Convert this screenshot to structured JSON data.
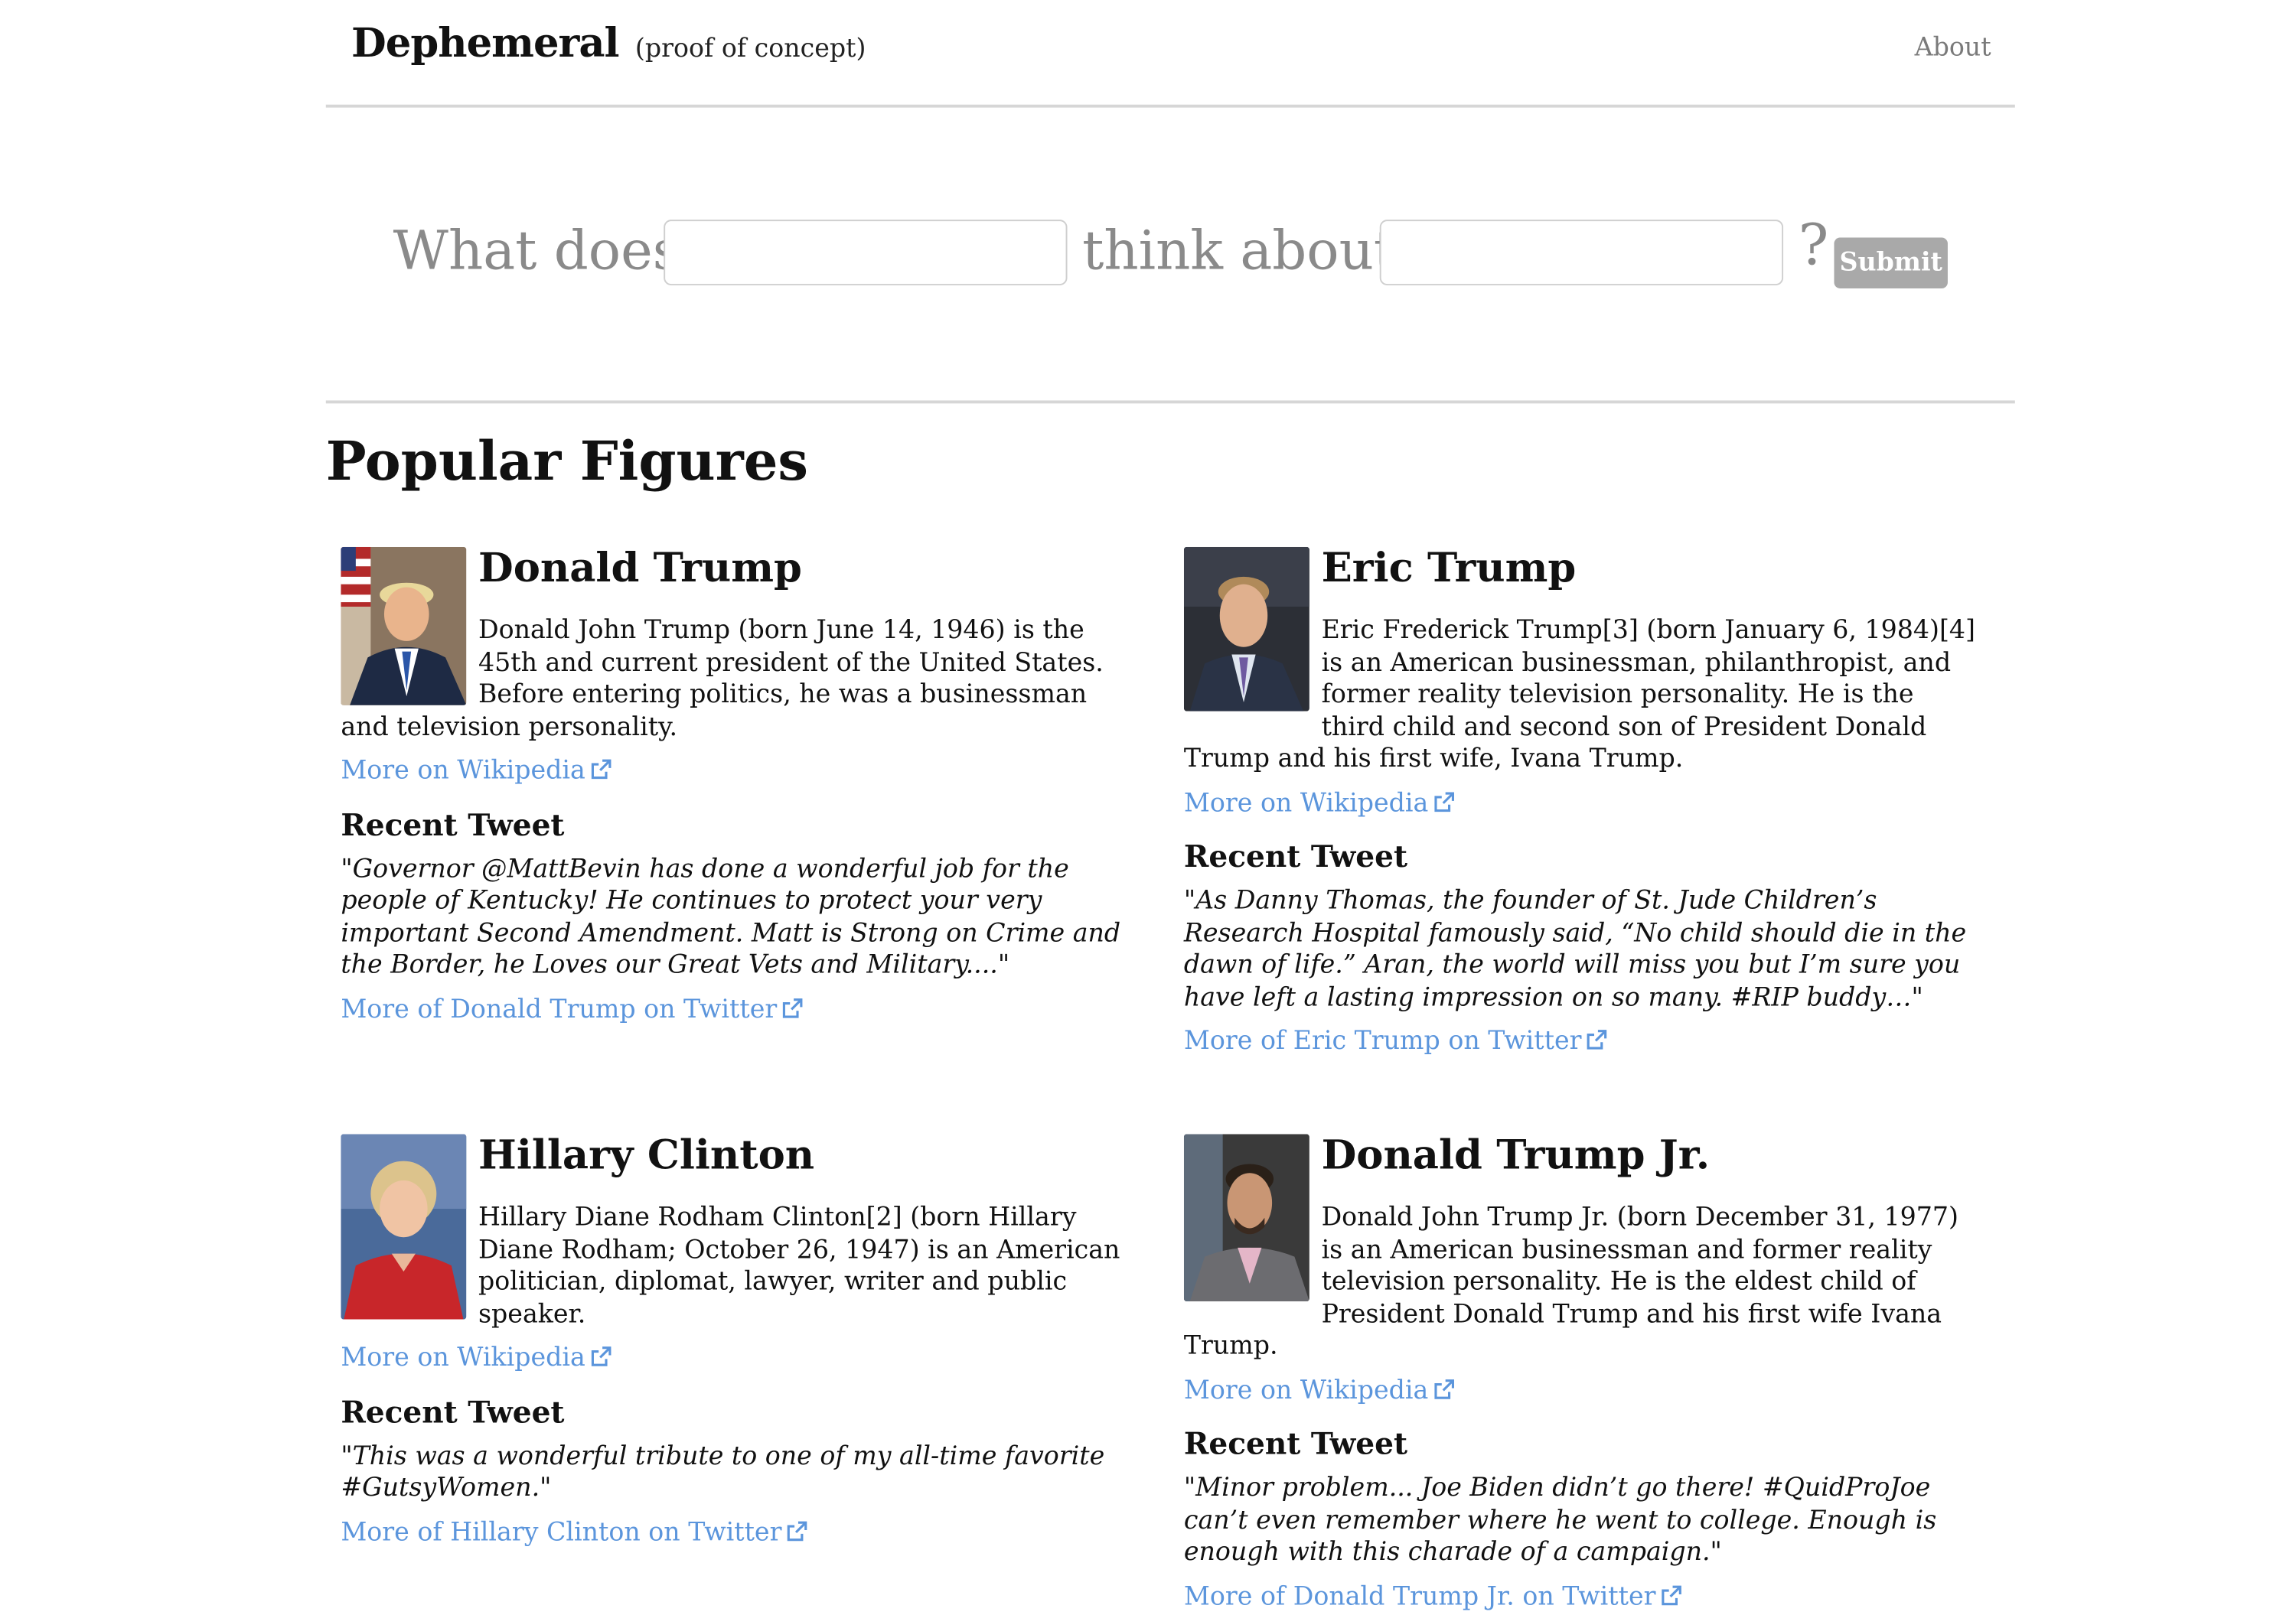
{
  "navbar": {
    "brand": "Dephemeral",
    "brand_sub": "(proof of concept)",
    "about": "About"
  },
  "search": {
    "prefix": "What does",
    "middle": "think about",
    "suffix": "?",
    "person_value": "",
    "topic_value": "",
    "submit": "Submit"
  },
  "popular": {
    "title": "Popular Figures",
    "recent_tweet_label": "Recent Tweet",
    "wiki_label": "More on Wikipedia",
    "figures": [
      {
        "name": "Donald Trump",
        "bio": "Donald John Trump (born June 14, 1946) is the 45th and current president of the United States. Before entering politics, he was a businessman and television personality.",
        "tweet": "\"Governor @MattBevin has done a wonderful job for the people of Kentucky! He continues to protect your very important Second Amendment. Matt is Strong on Crime and the Border, he Loves our Great Vets and Military....\"",
        "twitter_link": "More of Donald Trump on Twitter",
        "avatar_icon": "portrait-donald-trump"
      },
      {
        "name": "Eric Trump",
        "bio": "Eric Frederick Trump[3] (born January 6, 1984)[4] is an American businessman, philanthropist, and former reality television personality. He is the third child and second son of President Donald Trump and his first wife, Ivana Trump.",
        "tweet": "\"As Danny Thomas, the founder of St. Jude Children’s Research Hospital famously said, “No child should die in the dawn of life.” Aran, the world will miss you but I’m sure you have left a lasting impression on so many. #RIP buddy…\"",
        "twitter_link": "More of Eric Trump on Twitter",
        "avatar_icon": "portrait-eric-trump"
      },
      {
        "name": "Hillary Clinton",
        "bio": "Hillary Diane Rodham Clinton[2] (born Hillary Diane Rodham; October 26, 1947) is an American politician, diplomat, lawyer, writer and public speaker.",
        "tweet": "\"This was a wonderful tribute to one of my all-time favorite #GutsyWomen.\"",
        "twitter_link": "More of Hillary Clinton on Twitter",
        "avatar_icon": "portrait-hillary-clinton"
      },
      {
        "name": "Donald Trump Jr.",
        "bio": "Donald John Trump Jr. (born December 31, 1977) is an American businessman and former reality television personality. He is the eldest child of President Donald Trump and his first wife Ivana Trump.",
        "tweet": "\"Minor problem... Joe Biden didn’t go there! #QuidProJoe can’t even remember where he went to college. Enough is enough with this charade of a campaign.\"",
        "twitter_link": "More of Donald Trump Jr. on Twitter",
        "avatar_icon": "portrait-donald-trump-jr"
      }
    ]
  },
  "colors": {
    "link": "#5b95dc",
    "muted": "#8a8a8a",
    "button": "#a9a9a9",
    "rule": "#d6d6d6"
  }
}
